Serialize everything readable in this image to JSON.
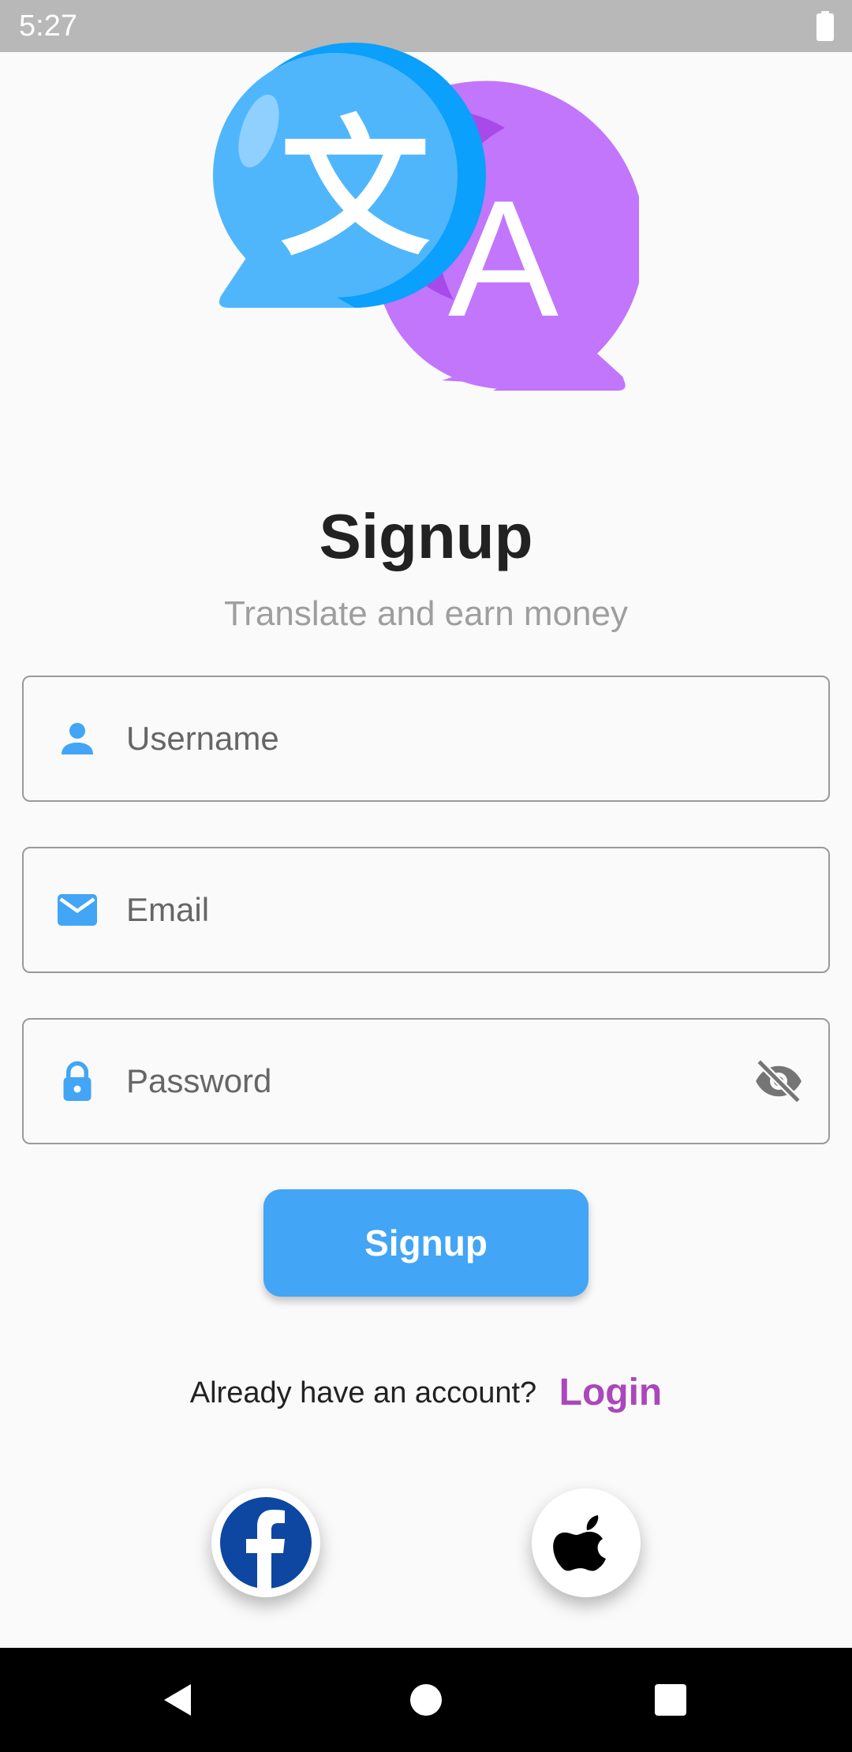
{
  "status_bar": {
    "time": "5:27",
    "battery_icon": "battery-full-icon"
  },
  "logo": {
    "glyph_left": "文",
    "glyph_right": "A",
    "colors": {
      "blue_bubble": "#4fb6fc",
      "purple_bubble": "#c176fc"
    }
  },
  "header": {
    "title": "Signup",
    "subtitle": "Translate and earn money"
  },
  "form": {
    "username": {
      "placeholder": "Username",
      "value": "",
      "icon": "person-icon"
    },
    "email": {
      "placeholder": "Email",
      "value": "",
      "icon": "mail-icon"
    },
    "password": {
      "placeholder": "Password",
      "value": "",
      "icon": "lock-icon",
      "toggle_icon": "eye-off-icon"
    },
    "submit_label": "Signup"
  },
  "login_prompt": {
    "text": "Already have an account?",
    "link": "Login"
  },
  "social": [
    {
      "name": "facebook",
      "icon": "facebook-icon"
    },
    {
      "name": "apple",
      "icon": "apple-icon"
    }
  ],
  "colors": {
    "accent": "#42a5f5",
    "link": "#ab47bc",
    "icon_blue": "#42a5f5",
    "facebook_blue": "#0d47a1"
  }
}
